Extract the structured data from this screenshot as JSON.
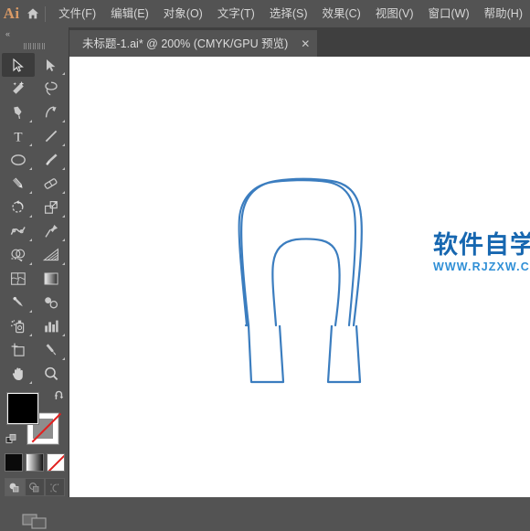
{
  "app": {
    "logo_text": "Ai",
    "home_icon": "home-icon"
  },
  "menu": {
    "items": [
      {
        "label": "文件(F)",
        "name": "menu-file"
      },
      {
        "label": "编辑(E)",
        "name": "menu-edit"
      },
      {
        "label": "对象(O)",
        "name": "menu-object"
      },
      {
        "label": "文字(T)",
        "name": "menu-type"
      },
      {
        "label": "选择(S)",
        "name": "menu-select"
      },
      {
        "label": "效果(C)",
        "name": "menu-effect"
      },
      {
        "label": "视图(V)",
        "name": "menu-view"
      },
      {
        "label": "窗口(W)",
        "name": "menu-window"
      },
      {
        "label": "帮助(H)",
        "name": "menu-help"
      }
    ]
  },
  "tab": {
    "title": "未标题-1.ai* @ 200% (CMYK/GPU 预览)",
    "close_label": "✕",
    "document_name": "未标题-1.ai",
    "modified": "*",
    "zoom": "200%",
    "color_mode": "CMYK",
    "preview_mode": "GPU 预览"
  },
  "toolbar": {
    "collapse_label": "«",
    "tools": [
      {
        "name": "selection-tool",
        "icon": "arrow-cursor-icon",
        "active": true,
        "has_flyout": false
      },
      {
        "name": "direct-selection-tool",
        "icon": "white-arrow-cursor-icon",
        "active": false,
        "has_flyout": true
      },
      {
        "name": "magic-wand-tool",
        "icon": "magic-wand-icon",
        "active": false,
        "has_flyout": false
      },
      {
        "name": "lasso-tool",
        "icon": "lasso-icon",
        "active": false,
        "has_flyout": false
      },
      {
        "name": "pen-tool",
        "icon": "pen-nib-icon",
        "active": false,
        "has_flyout": true
      },
      {
        "name": "curvature-tool",
        "icon": "curvature-icon",
        "active": false,
        "has_flyout": false
      },
      {
        "name": "type-tool",
        "icon": "type-T-icon",
        "active": false,
        "has_flyout": true
      },
      {
        "name": "line-segment-tool",
        "icon": "line-diagonal-icon",
        "active": false,
        "has_flyout": true
      },
      {
        "name": "ellipse-tool",
        "icon": "ellipse-icon",
        "active": false,
        "has_flyout": true
      },
      {
        "name": "paintbrush-tool",
        "icon": "paintbrush-icon",
        "active": false,
        "has_flyout": true
      },
      {
        "name": "shaper-pencil-tool",
        "icon": "pencil-icon",
        "active": false,
        "has_flyout": true
      },
      {
        "name": "eraser-tool",
        "icon": "eraser-icon",
        "active": false,
        "has_flyout": true
      },
      {
        "name": "rotate-tool",
        "icon": "rotate-icon",
        "active": false,
        "has_flyout": true
      },
      {
        "name": "scale-tool",
        "icon": "scale-icon",
        "active": false,
        "has_flyout": true
      },
      {
        "name": "width-warp-tool",
        "icon": "warp-icon",
        "active": false,
        "has_flyout": true
      },
      {
        "name": "puppet-warp-tool",
        "icon": "pushpin-icon",
        "active": false,
        "has_flyout": true
      },
      {
        "name": "shape-builder-tool",
        "icon": "shape-builder-icon",
        "active": false,
        "has_flyout": true
      },
      {
        "name": "perspective-grid-tool",
        "icon": "perspective-grid-icon",
        "active": false,
        "has_flyout": true
      },
      {
        "name": "mesh-tool",
        "icon": "mesh-icon",
        "active": false,
        "has_flyout": false
      },
      {
        "name": "gradient-tool",
        "icon": "gradient-icon",
        "active": false,
        "has_flyout": false
      },
      {
        "name": "eyedropper-tool",
        "icon": "eyedropper-icon",
        "active": false,
        "has_flyout": true
      },
      {
        "name": "blend-tool",
        "icon": "blend-icon",
        "active": false,
        "has_flyout": false
      },
      {
        "name": "symbol-sprayer-tool",
        "icon": "symbol-sprayer-icon",
        "active": false,
        "has_flyout": true
      },
      {
        "name": "column-graph-tool",
        "icon": "bar-chart-icon",
        "active": false,
        "has_flyout": true
      },
      {
        "name": "artboard-tool",
        "icon": "artboard-icon",
        "active": false,
        "has_flyout": false
      },
      {
        "name": "slice-tool",
        "icon": "knife-icon",
        "active": false,
        "has_flyout": true
      },
      {
        "name": "hand-tool",
        "icon": "hand-icon",
        "active": false,
        "has_flyout": true
      },
      {
        "name": "zoom-tool",
        "icon": "magnifier-icon",
        "active": false,
        "has_flyout": false
      }
    ],
    "fill_color": "#000000",
    "stroke_color": "none",
    "swap_icon": "swap-arrow-icon",
    "default_icon": "default-fill-stroke-icon",
    "color_modes": [
      {
        "name": "color-mode-button",
        "icon": "solid-color-icon",
        "selected": true
      },
      {
        "name": "gradient-mode-button",
        "icon": "gradient-swatch-icon",
        "selected": false
      },
      {
        "name": "none-mode-button",
        "icon": "none-swatch-icon",
        "selected": false
      }
    ],
    "draw_modes": [
      {
        "name": "draw-normal-button",
        "icon": "draw-normal-icon",
        "selected": true
      },
      {
        "name": "draw-behind-button",
        "icon": "draw-behind-icon",
        "selected": false
      },
      {
        "name": "draw-inside-button",
        "icon": "draw-inside-icon",
        "selected": false
      }
    ],
    "screen_mode": {
      "name": "screen-mode-button",
      "icon": "screen-mode-icon"
    }
  },
  "canvas": {
    "background": "#ffffff",
    "artwork": {
      "name": "horseshoe-u-shape-path",
      "stroke_color": "#3b7dbf",
      "stroke_width": 2,
      "fill": "none",
      "description": "U-shaped horseshoe outline path"
    }
  },
  "watermark": {
    "chinese": "软件自学网",
    "url": "WWW.RJZXW.COM",
    "color": "#1767b0",
    "url_color": "#2f8fd6"
  }
}
